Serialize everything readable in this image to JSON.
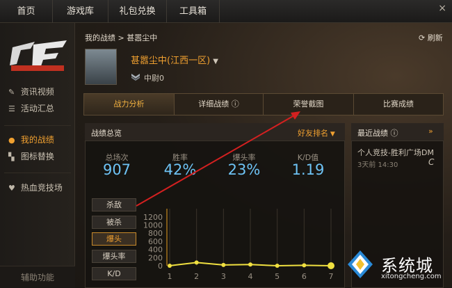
{
  "topnav": {
    "items": [
      "首页",
      "游戏库",
      "礼包兑换",
      "工具箱"
    ],
    "close": "×"
  },
  "sidebar": {
    "items": [
      {
        "icon": "wrench-icon",
        "label": "资讯视频"
      },
      {
        "icon": "list-icon",
        "label": "活动汇总"
      },
      {
        "icon": "user-icon",
        "label": "我的战绩"
      },
      {
        "icon": "shirt-icon",
        "label": "图标替换"
      },
      {
        "icon": "heart-icon",
        "label": "热血竞技场"
      }
    ],
    "aux": "辅助功能"
  },
  "header": {
    "breadcrumb": "我的战绩 > 甚嚣尘中",
    "refresh": "刷新",
    "player_name": "甚嚣尘中(江西一区)",
    "rank": "中尉0"
  },
  "tabs": [
    "战力分析",
    "详细战绩",
    "荣誉截图",
    "比赛成绩"
  ],
  "stats": {
    "title": "战绩总览",
    "friend_rank": "好友排名",
    "items": [
      {
        "label": "总场次",
        "value": "907"
      },
      {
        "label": "胜率",
        "value": "42%"
      },
      {
        "label": "爆头率",
        "value": "23%"
      },
      {
        "label": "K/D值",
        "value": "1.19"
      }
    ],
    "buttons": [
      "杀敌",
      "被杀",
      "爆头",
      "爆头率",
      "K/D"
    ]
  },
  "recent": {
    "title": "最近战绩",
    "match": "个人竞技-胜利广场DM",
    "time": "3天前 14:30",
    "mark": "C"
  },
  "watermark": {
    "text": "系统城",
    "url": "xitongcheng.com"
  },
  "chart_data": {
    "type": "line",
    "x": [
      1,
      2,
      3,
      4,
      5,
      6,
      7
    ],
    "y": [
      0,
      80,
      20,
      30,
      0,
      10,
      0
    ],
    "yticks": [
      0,
      200,
      400,
      600,
      800,
      1000,
      1200
    ],
    "ylim": [
      0,
      1300
    ],
    "xticks": [
      1,
      2,
      3,
      4,
      5,
      6,
      7
    ],
    "color": "#f0e040"
  }
}
